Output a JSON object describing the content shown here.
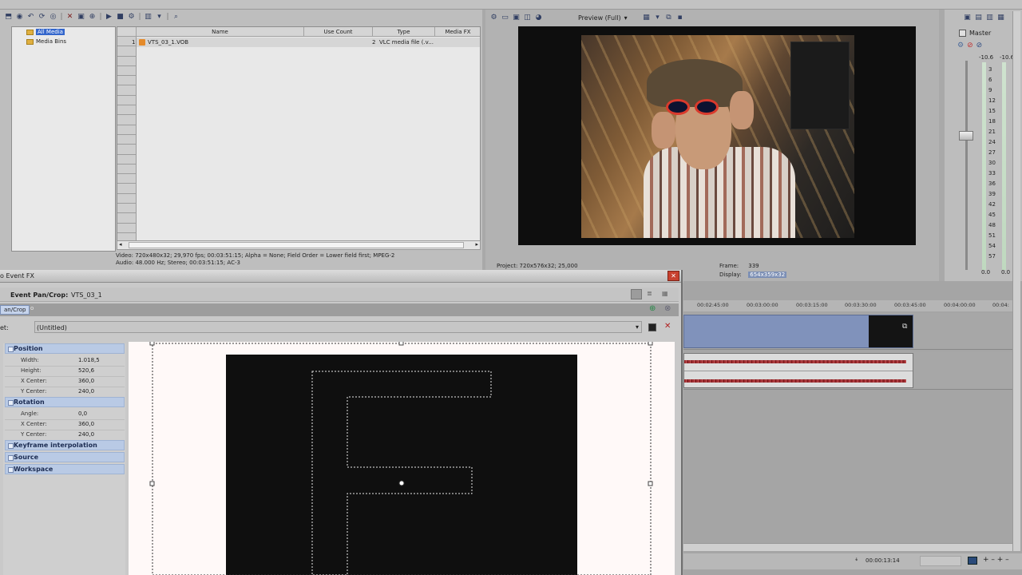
{
  "media": {
    "tree": {
      "all_media": "All Media",
      "media_bins": "Media Bins"
    },
    "columns": [
      "Name",
      "Use Count",
      "Type",
      "Media FX"
    ],
    "row": {
      "num": "1",
      "name": "VTS_03_1.VOB",
      "use_count": "2",
      "type": "VLC media file (.v..."
    },
    "info_video": "Video: 720x480x32; 29,970 fps; 00:03:51:15; Alpha = None; Field Order = Lower field first; MPEG-2",
    "info_audio": "Audio: 48.000 Hz; Stereo; 00:03:51:15; AC-3"
  },
  "preview": {
    "mode": "Preview (Full)",
    "project_label": "Project:",
    "project_value": "720x576x32; 25,000",
    "frame_label": "Frame:",
    "frame_value": "339",
    "display_label": "Display:",
    "display_value": "654x359x32"
  },
  "mixer": {
    "title": "Master",
    "peak_left": "-10.6",
    "peak_right": "-10.6",
    "scale": [
      "3",
      "6",
      "9",
      "12",
      "15",
      "18",
      "21",
      "24",
      "27",
      "30",
      "33",
      "36",
      "39",
      "42",
      "45",
      "48",
      "51",
      "54",
      "57"
    ],
    "bottom_left": "0.0",
    "bottom_right": "0.0"
  },
  "timeline": {
    "ticks": [
      "00:02:45:00",
      "00:03:00:00",
      "00:03:15:00",
      "00:03:30:00",
      "00:03:45:00",
      "00:04:00:00",
      "00:04:"
    ],
    "timecode": "00:00:13:14"
  },
  "fx": {
    "title": "o Event FX",
    "header_label": "Event Pan/Crop:",
    "header_value": "VTS_03_1",
    "tab": "an/Crop",
    "preset_label": "et:",
    "preset_value": "(Untitled)",
    "sections": {
      "position": "Position",
      "rotation": "Rotation",
      "keyframe": "Keyframe interpolation",
      "source": "Source",
      "workspace": "Workspace"
    },
    "position_props": [
      {
        "label": "Width:",
        "value": "1.018,5"
      },
      {
        "label": "Height:",
        "value": "520,6"
      },
      {
        "label": "X Center:",
        "value": "360,0"
      },
      {
        "label": "Y Center:",
        "value": "240,0"
      }
    ],
    "rotation_props": [
      {
        "label": "Angle:",
        "value": "0,0"
      },
      {
        "label": "X Center:",
        "value": "360,0"
      },
      {
        "label": "Y Center:",
        "value": "240,0"
      }
    ]
  }
}
